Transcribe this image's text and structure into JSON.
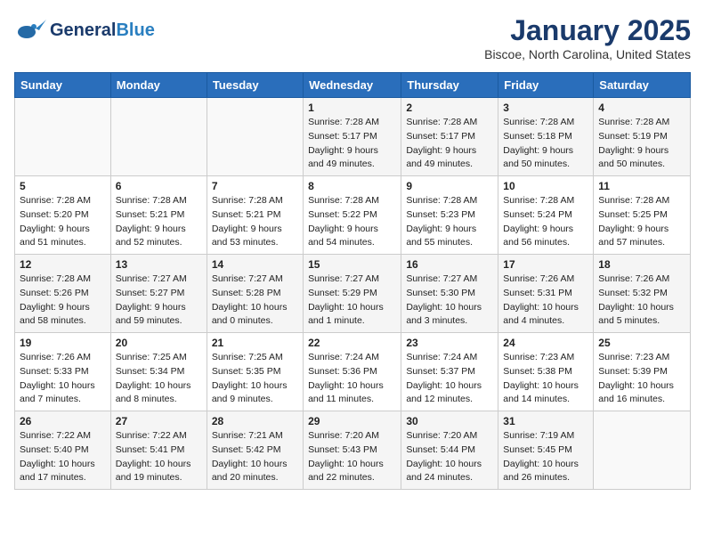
{
  "header": {
    "logo_general": "General",
    "logo_blue": "Blue",
    "month_title": "January 2025",
    "location": "Biscoe, North Carolina, United States"
  },
  "weekdays": [
    "Sunday",
    "Monday",
    "Tuesday",
    "Wednesday",
    "Thursday",
    "Friday",
    "Saturday"
  ],
  "weeks": [
    [
      {
        "day": "",
        "info": ""
      },
      {
        "day": "",
        "info": ""
      },
      {
        "day": "",
        "info": ""
      },
      {
        "day": "1",
        "info": "Sunrise: 7:28 AM\nSunset: 5:17 PM\nDaylight: 9 hours\nand 49 minutes."
      },
      {
        "day": "2",
        "info": "Sunrise: 7:28 AM\nSunset: 5:17 PM\nDaylight: 9 hours\nand 49 minutes."
      },
      {
        "day": "3",
        "info": "Sunrise: 7:28 AM\nSunset: 5:18 PM\nDaylight: 9 hours\nand 50 minutes."
      },
      {
        "day": "4",
        "info": "Sunrise: 7:28 AM\nSunset: 5:19 PM\nDaylight: 9 hours\nand 50 minutes."
      }
    ],
    [
      {
        "day": "5",
        "info": "Sunrise: 7:28 AM\nSunset: 5:20 PM\nDaylight: 9 hours\nand 51 minutes."
      },
      {
        "day": "6",
        "info": "Sunrise: 7:28 AM\nSunset: 5:21 PM\nDaylight: 9 hours\nand 52 minutes."
      },
      {
        "day": "7",
        "info": "Sunrise: 7:28 AM\nSunset: 5:21 PM\nDaylight: 9 hours\nand 53 minutes."
      },
      {
        "day": "8",
        "info": "Sunrise: 7:28 AM\nSunset: 5:22 PM\nDaylight: 9 hours\nand 54 minutes."
      },
      {
        "day": "9",
        "info": "Sunrise: 7:28 AM\nSunset: 5:23 PM\nDaylight: 9 hours\nand 55 minutes."
      },
      {
        "day": "10",
        "info": "Sunrise: 7:28 AM\nSunset: 5:24 PM\nDaylight: 9 hours\nand 56 minutes."
      },
      {
        "day": "11",
        "info": "Sunrise: 7:28 AM\nSunset: 5:25 PM\nDaylight: 9 hours\nand 57 minutes."
      }
    ],
    [
      {
        "day": "12",
        "info": "Sunrise: 7:28 AM\nSunset: 5:26 PM\nDaylight: 9 hours\nand 58 minutes."
      },
      {
        "day": "13",
        "info": "Sunrise: 7:27 AM\nSunset: 5:27 PM\nDaylight: 9 hours\nand 59 minutes."
      },
      {
        "day": "14",
        "info": "Sunrise: 7:27 AM\nSunset: 5:28 PM\nDaylight: 10 hours\nand 0 minutes."
      },
      {
        "day": "15",
        "info": "Sunrise: 7:27 AM\nSunset: 5:29 PM\nDaylight: 10 hours\nand 1 minute."
      },
      {
        "day": "16",
        "info": "Sunrise: 7:27 AM\nSunset: 5:30 PM\nDaylight: 10 hours\nand 3 minutes."
      },
      {
        "day": "17",
        "info": "Sunrise: 7:26 AM\nSunset: 5:31 PM\nDaylight: 10 hours\nand 4 minutes."
      },
      {
        "day": "18",
        "info": "Sunrise: 7:26 AM\nSunset: 5:32 PM\nDaylight: 10 hours\nand 5 minutes."
      }
    ],
    [
      {
        "day": "19",
        "info": "Sunrise: 7:26 AM\nSunset: 5:33 PM\nDaylight: 10 hours\nand 7 minutes."
      },
      {
        "day": "20",
        "info": "Sunrise: 7:25 AM\nSunset: 5:34 PM\nDaylight: 10 hours\nand 8 minutes."
      },
      {
        "day": "21",
        "info": "Sunrise: 7:25 AM\nSunset: 5:35 PM\nDaylight: 10 hours\nand 9 minutes."
      },
      {
        "day": "22",
        "info": "Sunrise: 7:24 AM\nSunset: 5:36 PM\nDaylight: 10 hours\nand 11 minutes."
      },
      {
        "day": "23",
        "info": "Sunrise: 7:24 AM\nSunset: 5:37 PM\nDaylight: 10 hours\nand 12 minutes."
      },
      {
        "day": "24",
        "info": "Sunrise: 7:23 AM\nSunset: 5:38 PM\nDaylight: 10 hours\nand 14 minutes."
      },
      {
        "day": "25",
        "info": "Sunrise: 7:23 AM\nSunset: 5:39 PM\nDaylight: 10 hours\nand 16 minutes."
      }
    ],
    [
      {
        "day": "26",
        "info": "Sunrise: 7:22 AM\nSunset: 5:40 PM\nDaylight: 10 hours\nand 17 minutes."
      },
      {
        "day": "27",
        "info": "Sunrise: 7:22 AM\nSunset: 5:41 PM\nDaylight: 10 hours\nand 19 minutes."
      },
      {
        "day": "28",
        "info": "Sunrise: 7:21 AM\nSunset: 5:42 PM\nDaylight: 10 hours\nand 20 minutes."
      },
      {
        "day": "29",
        "info": "Sunrise: 7:20 AM\nSunset: 5:43 PM\nDaylight: 10 hours\nand 22 minutes."
      },
      {
        "day": "30",
        "info": "Sunrise: 7:20 AM\nSunset: 5:44 PM\nDaylight: 10 hours\nand 24 minutes."
      },
      {
        "day": "31",
        "info": "Sunrise: 7:19 AM\nSunset: 5:45 PM\nDaylight: 10 hours\nand 26 minutes."
      },
      {
        "day": "",
        "info": ""
      }
    ]
  ]
}
